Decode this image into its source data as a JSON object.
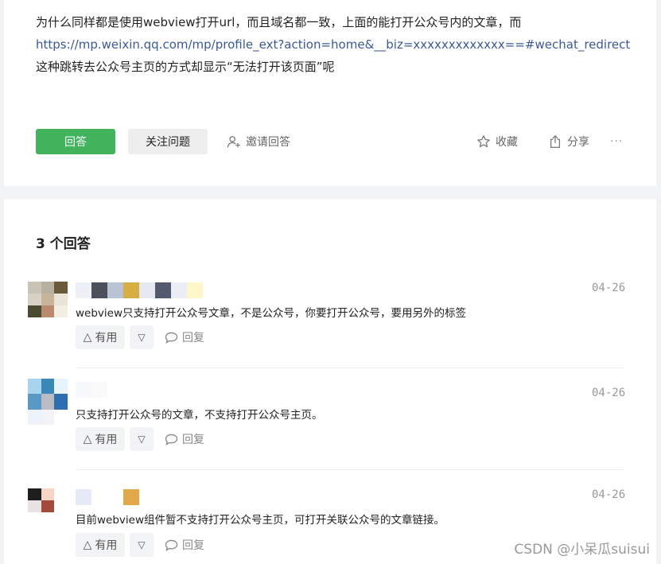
{
  "question": {
    "text_before": "为什么同样都是使用webview打开url，而且域名都一致，上面的能打开公众号内的文章，而",
    "link": "https://mp.weixin.qq.com/mp/profile_ext?action=home&__biz=xxxxxxxxxxxxx==#wechat_redirect",
    "text_after": "这种跳转去公众号主页的方式却显示“无法打开该页面”呢"
  },
  "actions": {
    "answer_label": "回答",
    "follow_label": "关注问题",
    "invite_label": "邀请回答",
    "collect_label": "收藏",
    "share_label": "分享",
    "more_label": "···"
  },
  "answers_header": {
    "count_label": "3 个回答"
  },
  "answers": [
    {
      "date": "04-26",
      "text": "webview只支持打开公众号文章，不是公众号，你要打开公众号，要用另外的标签",
      "useful_label": "有用",
      "reply_label": "回复"
    },
    {
      "date": "04-26",
      "text": "只支持打开公众号的文章，不支持打开公众号主页。",
      "useful_label": "有用",
      "reply_label": "回复"
    },
    {
      "date": "04-26",
      "text": "目前webview组件暂不支持打开公众号主页，可打开关联公众号的文章链接。",
      "useful_label": "有用",
      "reply_label": "回复"
    }
  ],
  "watermark": "CSDN @小呆瓜suisui",
  "colors": {
    "accent_green": "#41b35d",
    "link_blue": "#3b5998",
    "page_bg": "#f2f3f5"
  },
  "icons": {
    "invite": "add-user-icon",
    "collect": "star-icon",
    "share": "share-icon",
    "reply": "comment-bubble-icon",
    "vote_up": "triangle-up-icon",
    "vote_down": "triangle-down-icon"
  }
}
